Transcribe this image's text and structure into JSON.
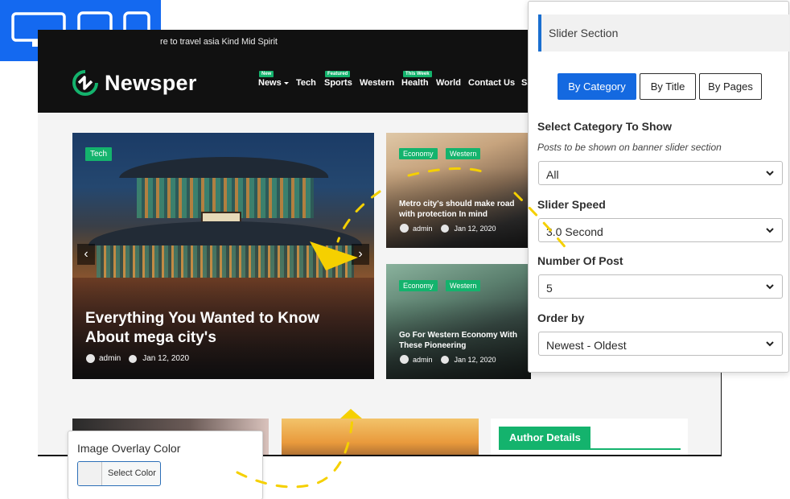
{
  "device_switch": {
    "desktop_icon": "desktop-icon",
    "tablet_icon": "tablet-icon",
    "mobile_icon": "mobile-icon",
    "color": "#1469f0"
  },
  "site": {
    "topbar_text": "re to travel asia Kind Mid Spirit",
    "logo_text": "Newsper",
    "nav": [
      {
        "label": "News",
        "badge": "New",
        "has_caret": true
      },
      {
        "label": "Tech",
        "badge": ""
      },
      {
        "label": "Sports",
        "badge": "Featured"
      },
      {
        "label": "Western",
        "badge": ""
      },
      {
        "label": "Health",
        "badge": "This Week"
      },
      {
        "label": "World",
        "badge": ""
      },
      {
        "label": "Contact Us",
        "badge": ""
      },
      {
        "label": "Sa",
        "badge": ""
      }
    ],
    "hero": {
      "tag": "Tech",
      "title": "Everything You Wanted to Know About mega city's",
      "author": "admin",
      "date": "Jan 12, 2020",
      "prev_glyph": "‹",
      "next_glyph": "›"
    },
    "cards": [
      {
        "tags": [
          "Economy",
          "Western"
        ],
        "title": "Metro city's should make road with protection In mind",
        "author": "admin",
        "date": "Jan 12, 2020"
      },
      {
        "tags": [
          "Economy",
          "Western"
        ],
        "title": "Go For Western Economy With These Pioneering",
        "author": "admin",
        "date": "Jan 12, 2020"
      }
    ],
    "author_details": "Author Details",
    "accent_color": "#14b36d"
  },
  "slider_panel": {
    "title": "Slider Section",
    "tabs": [
      {
        "label": "By Category",
        "active": true
      },
      {
        "label": "By Title",
        "active": false
      },
      {
        "label": "By Pages",
        "active": false
      }
    ],
    "category": {
      "label": "Select Category To Show",
      "help": "Posts to be shown on banner slider section",
      "value": "All"
    },
    "speed": {
      "label": "Slider Speed",
      "value": "3.0 Second"
    },
    "number": {
      "label": "Number Of Post",
      "value": "5"
    },
    "order": {
      "label": "Order by",
      "value": "Newest - Oldest"
    },
    "accent_color": "#1469e0"
  },
  "overlay": {
    "label": "Image Overlay Color",
    "button": "Select Color"
  }
}
